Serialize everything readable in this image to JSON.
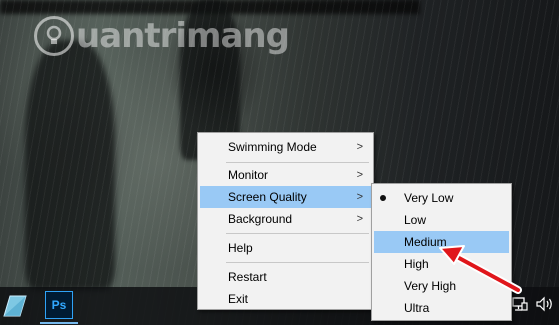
{
  "watermark": {
    "text": "uantrimang"
  },
  "context_menu": {
    "items": [
      {
        "label": "Swimming Mode",
        "has_submenu": true,
        "highlighted": false
      },
      {
        "label": "Monitor",
        "has_submenu": true,
        "highlighted": false
      },
      {
        "label": "Screen Quality",
        "has_submenu": true,
        "highlighted": true
      },
      {
        "label": "Background",
        "has_submenu": true,
        "highlighted": false
      },
      {
        "label": "Help",
        "has_submenu": false,
        "highlighted": false
      },
      {
        "label": "Restart",
        "has_submenu": false,
        "highlighted": false
      },
      {
        "label": "Exit",
        "has_submenu": false,
        "highlighted": false
      }
    ],
    "submenu_arrow": ">"
  },
  "quality_submenu": {
    "items": [
      {
        "label": "Very Low",
        "selected": true,
        "highlighted": false
      },
      {
        "label": "Low",
        "selected": false,
        "highlighted": false
      },
      {
        "label": "Medium",
        "selected": false,
        "highlighted": true
      },
      {
        "label": "High",
        "selected": false,
        "highlighted": false
      },
      {
        "label": "Very High",
        "selected": false,
        "highlighted": false
      },
      {
        "label": "Ultra",
        "selected": false,
        "highlighted": false
      }
    ]
  },
  "taskbar": {
    "apps": [
      {
        "name": "aquarium-app-icon"
      },
      {
        "name": "photoshop-icon",
        "label": "Ps"
      }
    ],
    "tray": [
      "network-icon",
      "volume-icon"
    ]
  },
  "colors": {
    "menu_bg": "#f2f2f2",
    "highlight": "#99c9f5",
    "annotation": "#e0161b",
    "taskbar": "#0c0e10"
  }
}
